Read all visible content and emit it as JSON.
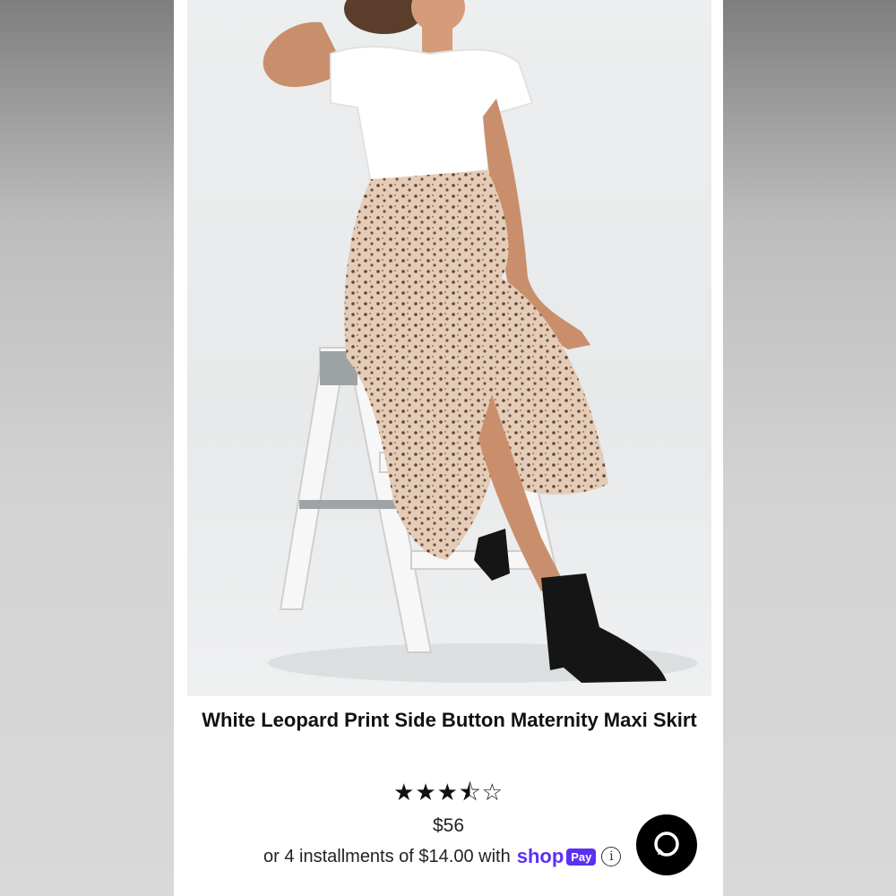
{
  "product": {
    "title": "White Leopard Print Side Button Maternity Maxi Skirt",
    "rating_stars": "★★★⯪☆",
    "price": "$56"
  },
  "payment": {
    "installments_text": "or 4 installments of $14.00 with",
    "shop_label": "shop",
    "pay_label": "Pay",
    "info_glyph": "i"
  },
  "icons": {
    "chat": "chat-icon"
  },
  "colors": {
    "shop_pay_purple": "#5a31f4",
    "chat_button_bg": "#000000"
  }
}
